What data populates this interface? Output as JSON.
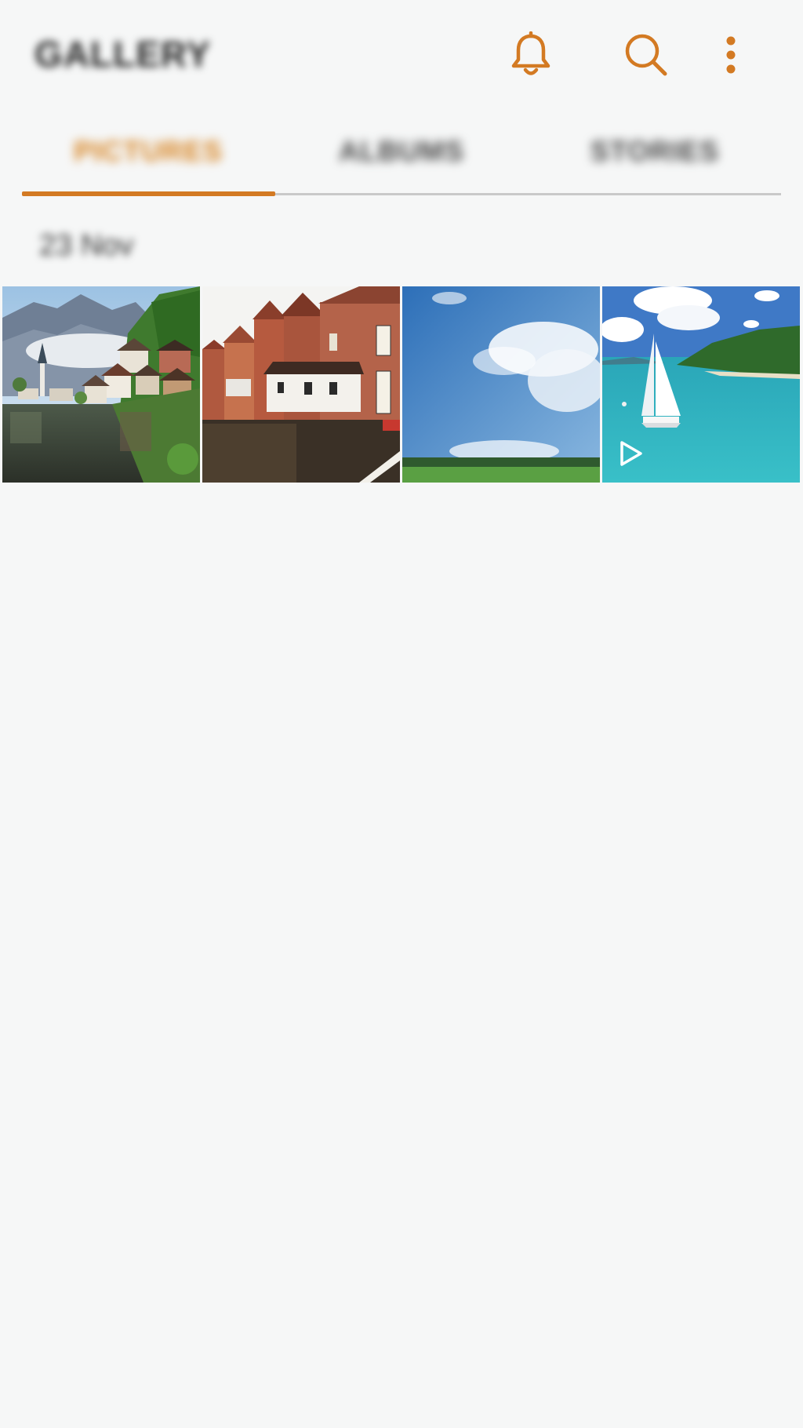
{
  "app_bar": {
    "title": "GALLERY",
    "actions": [
      {
        "icon": "bell-icon"
      },
      {
        "icon": "search-icon"
      },
      {
        "icon": "more-vert-icon"
      }
    ]
  },
  "tabs": [
    {
      "label": "PICTURES",
      "active": true
    },
    {
      "label": "ALBUMS",
      "active": false
    },
    {
      "label": "STORIES",
      "active": false
    }
  ],
  "section": {
    "date_label": "23 Nov"
  },
  "thumbnails": [
    {
      "subject": "alpine-lake-village",
      "video": false
    },
    {
      "subject": "canal-brick-houses",
      "video": false
    },
    {
      "subject": "sky-and-meadow",
      "video": false
    },
    {
      "subject": "sailboat-tropical-sea",
      "video": true
    }
  ],
  "colors": {
    "accent": "#d37a23",
    "background": "#f6f7f7",
    "tab_track": "#c9c9c9"
  }
}
